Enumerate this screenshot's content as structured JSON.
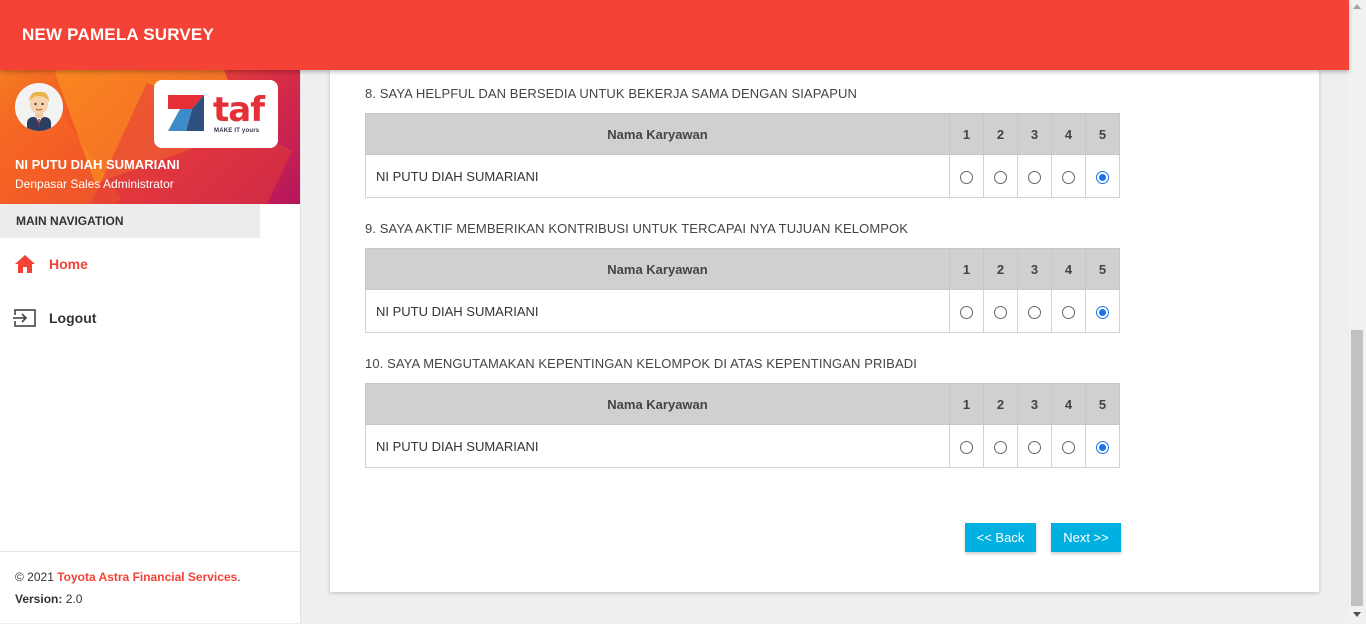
{
  "app": {
    "title": "NEW PAMELA SURVEY"
  },
  "brand": {
    "logo_text": "taf",
    "tagline": "MAKE IT yours"
  },
  "user": {
    "name": "NI PUTU DIAH SUMARIANI",
    "role": "Denpasar Sales Administrator"
  },
  "sidebar": {
    "header": "MAIN NAVIGATION",
    "items": [
      {
        "label": "Home",
        "icon": "home-icon",
        "active": true
      },
      {
        "label": "Logout",
        "icon": "logout-icon",
        "active": false
      }
    ]
  },
  "footer": {
    "copyright_prefix": "© 2021",
    "company": "Toyota Astra Financial Services",
    "copyright_suffix": ".",
    "version_label": "Version:",
    "version_value": "2.0"
  },
  "questions": [
    {
      "text": "8. SAYA HELPFUL DAN BERSEDIA UNTUK BEKERJA SAMA DENGAN SIAPAPUN",
      "header_name": "Nama Karyawan",
      "scale": [
        "1",
        "2",
        "3",
        "4",
        "5"
      ],
      "employee": "NI PUTU DIAH SUMARIANI",
      "selected": "5"
    },
    {
      "text": "9. SAYA AKTIF MEMBERIKAN KONTRIBUSI UNTUK TERCAPAI NYA TUJUAN KELOMPOK",
      "header_name": "Nama Karyawan",
      "scale": [
        "1",
        "2",
        "3",
        "4",
        "5"
      ],
      "employee": "NI PUTU DIAH SUMARIANI",
      "selected": "5"
    },
    {
      "text": "10. SAYA MENGUTAMAKAN KEPENTINGAN KELOMPOK DI ATAS KEPENTINGAN PRIBADI",
      "header_name": "Nama Karyawan",
      "scale": [
        "1",
        "2",
        "3",
        "4",
        "5"
      ],
      "employee": "NI PUTU DIAH SUMARIANI",
      "selected": "5"
    }
  ],
  "buttons": {
    "back": "<< Back",
    "next": "Next >>"
  },
  "colors": {
    "primary": "#f44336",
    "button": "#00b0e0",
    "radio_checked": "#1a73e8"
  }
}
